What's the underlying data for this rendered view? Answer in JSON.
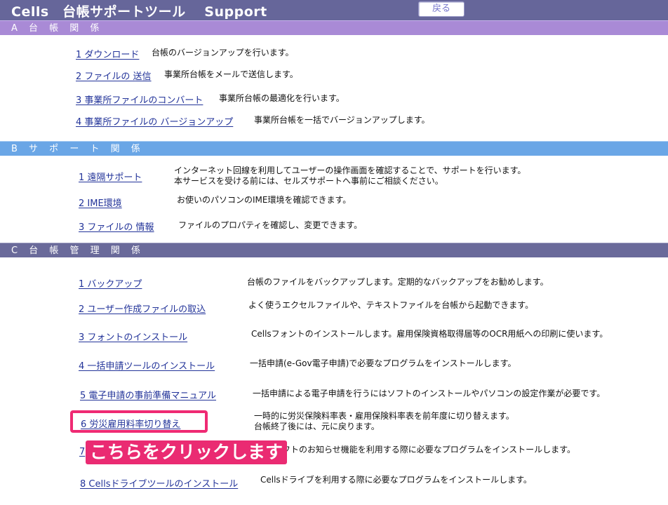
{
  "header": {
    "title": "Cells　台帳サポートツール　 Support",
    "back_label": "戻る"
  },
  "sections": {
    "a": {
      "title": "A 台 帳 関 係"
    },
    "b": {
      "title": "B サ ポ ー ト 関 係"
    },
    "c": {
      "title": "C 台 帳 管 理 関 係"
    }
  },
  "items": {
    "a1": {
      "label": "1 ダウンロード",
      "desc": "台帳のバージョンアップを行います。"
    },
    "a2": {
      "label": "2 ファイルの 送信",
      "desc": "事業所台帳をメールで送信します。"
    },
    "a3": {
      "label": "3 事業所ファイルのコンバート",
      "desc": "事業所台帳の最適化を行います。"
    },
    "a4": {
      "label": "4 事業所ファイルの バージョンアップ",
      "desc": "事業所台帳を一括でバージョンアップします。"
    },
    "b1": {
      "label": "1 遠隔サポート",
      "desc_line1": "インターネット回線を利用してユーザーの操作画面を確認することで、サポートを行います。",
      "desc_line2": "本サービスを受ける前には、セルズサポートへ事前にご相談ください。"
    },
    "b2": {
      "label": "2 IME環境",
      "desc": "お使いのパソコンのIME環境を確認できます。"
    },
    "b3": {
      "label": "3 ファイルの 情報",
      "desc": "ファイルのプロパティを確認し、変更できます。"
    },
    "c1": {
      "label": "1 バックアップ",
      "desc": "台帳のファイルをバックアップします。定期的なバックアップをお勧めします。"
    },
    "c2": {
      "label": "2 ユーザー作成ファイルの取込",
      "desc": "よく使うエクセルファイルや、テキストファイルを台帳から起動できます。"
    },
    "c3": {
      "label": "3 フォントのインストール",
      "desc": "Cellsフォントのインストールします。雇用保険資格取得届等のOCR用紙への印刷に使います。"
    },
    "c4": {
      "label": "4 一括申請ツールのインストール",
      "desc": "一括申請(e-Gov電子申請)で必要なプログラムをインストールします。"
    },
    "c5": {
      "label": "5 電子申請の事前準備マニュアル",
      "desc": "一括申請による電子申請を行うにはソフトのインストールやパソコンの設定作業が必要です。"
    },
    "c6": {
      "label": "6 労災雇用料率切り替え",
      "desc_line1": "一時的に労災保険料率表・雇用保険料率表を前年度に切り替えます。",
      "desc_line2": "台帳終了後には、元に戻ります。"
    },
    "c7": {
      "label": "7",
      "desc": "ルズソフトのお知らせ機能を利用する際に必要なプログラムをインストールします。"
    },
    "c8": {
      "label": "8 Cellsドライブツールのインストール",
      "desc": "Cellsドライブを利用する際に必要なプログラムをインストールします。"
    }
  },
  "annotation": {
    "callout_text": "こちらをクリックします",
    "highlight_color": "#ef2a73"
  }
}
